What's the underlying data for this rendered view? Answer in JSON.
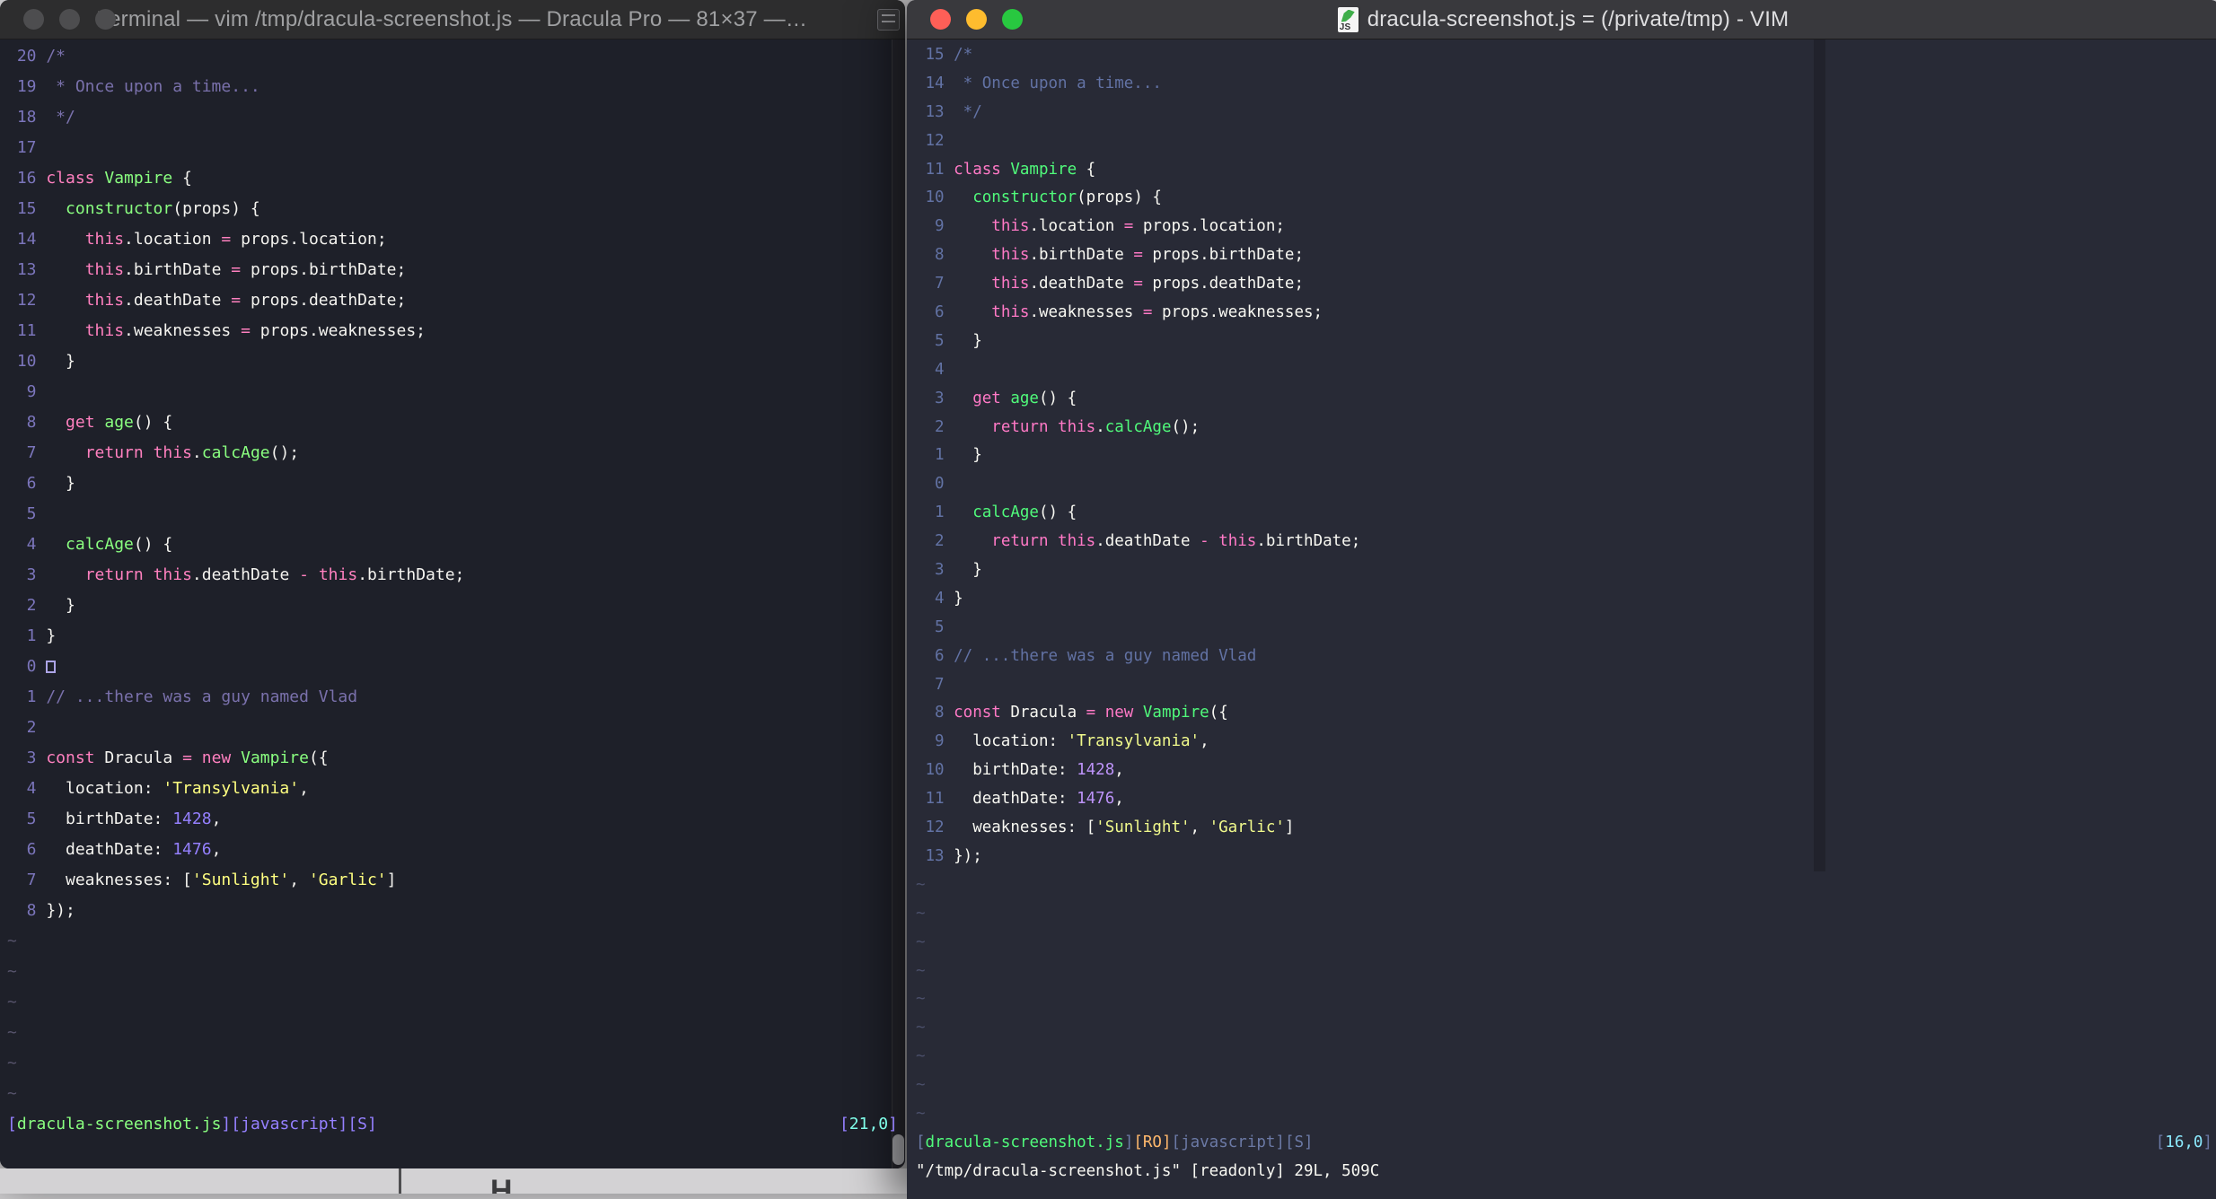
{
  "code_lines": [
    [
      [
        "c",
        "/*"
      ]
    ],
    [
      [
        "c",
        " * Once upon a time..."
      ]
    ],
    [
      [
        "c",
        " */"
      ]
    ],
    [],
    [
      [
        "p",
        "class"
      ],
      [
        "f",
        " "
      ],
      [
        "g",
        "Vampire"
      ],
      [
        "f",
        " {"
      ]
    ],
    [
      [
        "f",
        "  "
      ],
      [
        "g",
        "constructor"
      ],
      [
        "f",
        "(props) {"
      ]
    ],
    [
      [
        "f",
        "    "
      ],
      [
        "p",
        "this"
      ],
      [
        "f",
        ".location "
      ],
      [
        "p",
        "="
      ],
      [
        "f",
        " props.location;"
      ]
    ],
    [
      [
        "f",
        "    "
      ],
      [
        "p",
        "this"
      ],
      [
        "f",
        ".birthDate "
      ],
      [
        "p",
        "="
      ],
      [
        "f",
        " props.birthDate;"
      ]
    ],
    [
      [
        "f",
        "    "
      ],
      [
        "p",
        "this"
      ],
      [
        "f",
        ".deathDate "
      ],
      [
        "p",
        "="
      ],
      [
        "f",
        " props.deathDate;"
      ]
    ],
    [
      [
        "f",
        "    "
      ],
      [
        "p",
        "this"
      ],
      [
        "f",
        ".weaknesses "
      ],
      [
        "p",
        "="
      ],
      [
        "f",
        " props.weaknesses;"
      ]
    ],
    [
      [
        "f",
        "  }"
      ]
    ],
    [],
    [
      [
        "f",
        "  "
      ],
      [
        "p",
        "get"
      ],
      [
        "f",
        " "
      ],
      [
        "g",
        "age"
      ],
      [
        "f",
        "() {"
      ]
    ],
    [
      [
        "f",
        "    "
      ],
      [
        "p",
        "return"
      ],
      [
        "f",
        " "
      ],
      [
        "p",
        "this"
      ],
      [
        "f",
        "."
      ],
      [
        "g",
        "calcAge"
      ],
      [
        "f",
        "();"
      ]
    ],
    [
      [
        "f",
        "  }"
      ]
    ],
    [],
    [
      [
        "f",
        "  "
      ],
      [
        "g",
        "calcAge"
      ],
      [
        "f",
        "() {"
      ]
    ],
    [
      [
        "f",
        "    "
      ],
      [
        "p",
        "return"
      ],
      [
        "f",
        " "
      ],
      [
        "p",
        "this"
      ],
      [
        "f",
        ".deathDate "
      ],
      [
        "p",
        "-"
      ],
      [
        "f",
        " "
      ],
      [
        "p",
        "this"
      ],
      [
        "f",
        ".birthDate;"
      ]
    ],
    [
      [
        "f",
        "  }"
      ]
    ],
    [
      [
        "f",
        "}"
      ]
    ],
    [],
    [
      [
        "c",
        "// ...there was a guy named Vlad"
      ]
    ],
    [],
    [
      [
        "p",
        "const"
      ],
      [
        "f",
        " Dracula "
      ],
      [
        "p",
        "="
      ],
      [
        "f",
        " "
      ],
      [
        "p",
        "new"
      ],
      [
        "f",
        " "
      ],
      [
        "g",
        "Vampire"
      ],
      [
        "f",
        "({"
      ]
    ],
    [
      [
        "f",
        "  location: "
      ],
      [
        "y",
        "'Transylvania'"
      ],
      [
        "f",
        ","
      ]
    ],
    [
      [
        "f",
        "  birthDate: "
      ],
      [
        "u",
        "1428"
      ],
      [
        "f",
        ","
      ]
    ],
    [
      [
        "f",
        "  deathDate: "
      ],
      [
        "u",
        "1476"
      ],
      [
        "f",
        ","
      ]
    ],
    [
      [
        "f",
        "  weaknesses: ["
      ],
      [
        "y",
        "'Sunlight'"
      ],
      [
        "f",
        ", "
      ],
      [
        "y",
        "'Garlic'"
      ],
      [
        "f",
        "]"
      ]
    ],
    [
      [
        "f",
        "});"
      ]
    ]
  ],
  "windows": [
    {
      "title": "Terminal — vim /tmp/dracula-screenshot.js — Dracula Pro — 81×37 —…",
      "line_numbers": [
        "20",
        "19",
        "18",
        "17",
        "16",
        "15",
        "14",
        "13",
        "12",
        "11",
        "10",
        "9",
        "8",
        "7",
        "6",
        "5",
        "4",
        "3",
        "2",
        "1",
        "0",
        "1",
        "2",
        "3",
        "4",
        "5",
        "6",
        "7",
        "8"
      ],
      "cursor_row": 20,
      "tilde_count": 6,
      "tilde_char": "~",
      "status_tokens": [
        [
          "P",
          "["
        ],
        [
          "g",
          "dracula-screenshot.js"
        ],
        [
          "P",
          "]["
        ],
        [
          "P",
          "javascript"
        ],
        [
          "P",
          "]["
        ],
        [
          "P",
          "S"
        ],
        [
          "P",
          "]"
        ]
      ],
      "ruler_tokens": [
        [
          "P",
          "["
        ],
        [
          "n",
          "21,0"
        ],
        [
          "P",
          "]"
        ]
      ],
      "cmdline_tokens": [],
      "tokens": {
        "f": "#f4f3ef",
        "c": "#7a71ac",
        "p": "#ff80bf",
        "g": "#8aff80",
        "y": "#ffff80",
        "u": "#9580ff",
        "n": "#80ffea",
        "P": "#9580ff",
        "ln": "#7b75bb",
        "t": "#56536b"
      }
    },
    {
      "title": "dracula-screenshot.js = (/private/tmp) - VIM",
      "line_numbers": [
        "15",
        "14",
        "13",
        "12",
        "11",
        "10",
        "9",
        "8",
        "7",
        "6",
        "5",
        "4",
        "3",
        "2",
        "1",
        "0",
        "1",
        "2",
        "3",
        "4",
        "5",
        "6",
        "7",
        "8",
        "9",
        "10",
        "11",
        "12",
        "13"
      ],
      "cursor_row": null,
      "tilde_count": 9,
      "tilde_char": "~",
      "status_tokens": [
        [
          "s",
          "["
        ],
        [
          "g",
          "dracula-screenshot.js"
        ],
        [
          "s",
          "]"
        ],
        [
          "o",
          "[RO]"
        ],
        [
          "s",
          "["
        ],
        [
          "s",
          "javascript"
        ],
        [
          "s",
          "]["
        ],
        [
          "s",
          "S"
        ],
        [
          "s",
          "]"
        ]
      ],
      "ruler_tokens": [
        [
          "s",
          "["
        ],
        [
          "n",
          "16,0"
        ],
        [
          "s",
          "]"
        ]
      ],
      "cmdline_tokens": [
        [
          "f",
          "\"/tmp/dracula-screenshot.js\" [readonly] 29L, 509C"
        ]
      ],
      "tokens": {
        "f": "#f8f8f2",
        "c": "#6272a4",
        "p": "#ff79c6",
        "g": "#50fa7b",
        "y": "#f1fa8c",
        "u": "#bd93f9",
        "n": "#8be9fd",
        "s": "#6b79a5",
        "o": "#ffb86c",
        "ln": "#6272a4",
        "t": "#4a4f6a"
      }
    }
  ],
  "traffic_lights": {
    "inactive_color": "#4d4d4f",
    "close_color": "#ff5f57",
    "minimize_color": "#febc2e",
    "zoom_color": "#28c840"
  },
  "doc_icon_label": "JS",
  "desktop": {
    "artifact_glyph": "H"
  }
}
